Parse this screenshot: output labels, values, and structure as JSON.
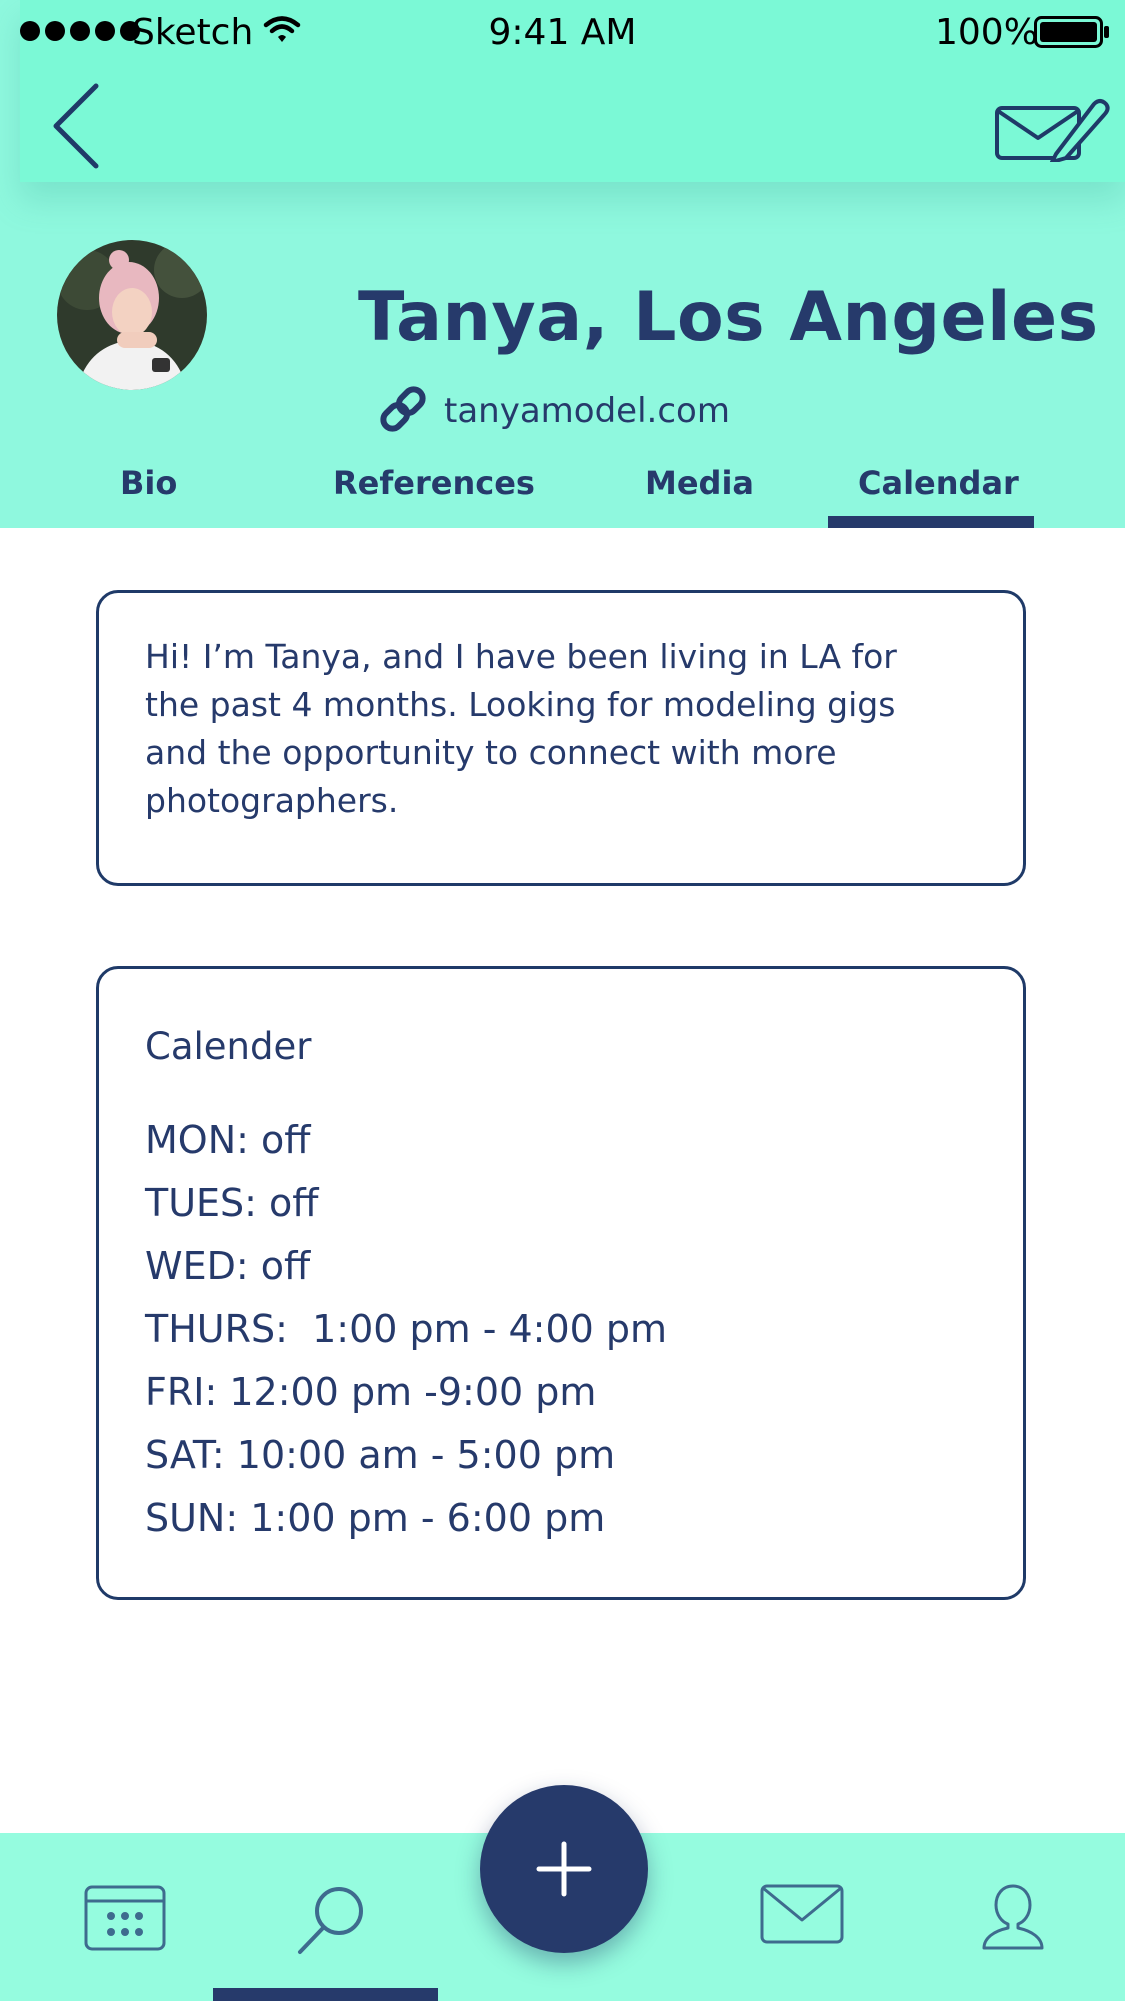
{
  "status_bar": {
    "carrier": "Sketch",
    "time": "9:41 AM",
    "battery": "100%"
  },
  "nav": {
    "back_icon": "chevron-left-icon",
    "compose_icon": "mail-compose-icon"
  },
  "profile": {
    "name": "Tanya, Los Angeles",
    "website": "tanyamodel.com",
    "link_icon": "link-icon"
  },
  "tabs": [
    {
      "label": "Bio",
      "active": false
    },
    {
      "label": "References",
      "active": false
    },
    {
      "label": "Media",
      "active": false
    },
    {
      "label": "Calendar",
      "active": true
    }
  ],
  "bio": {
    "text": "Hi! I’m Tanya, and I have been living in LA for the past 4 months. Looking for modeling gigs and the opportunity to connect with more photographers."
  },
  "calendar": {
    "title": "Calender",
    "schedule": [
      "MON: off",
      "TUES: off",
      "WED: off",
      "THURS:  1:00 pm - 4:00 pm",
      "FRI: 12:00 pm -9:00 pm",
      "SAT: 10:00 am - 5:00 pm",
      "SUN: 1:00 pm - 6:00 pm"
    ]
  },
  "tab_bar": {
    "items": [
      "calendar-icon",
      "search-icon",
      "add-icon",
      "mail-icon",
      "profile-icon"
    ],
    "active": "search-icon"
  },
  "colors": {
    "primary_navy": "#263A6B",
    "header_mint": "#8FF8DE",
    "nav_mint": "#7BF9D6",
    "tabbar_mint": "#95FCDF"
  }
}
